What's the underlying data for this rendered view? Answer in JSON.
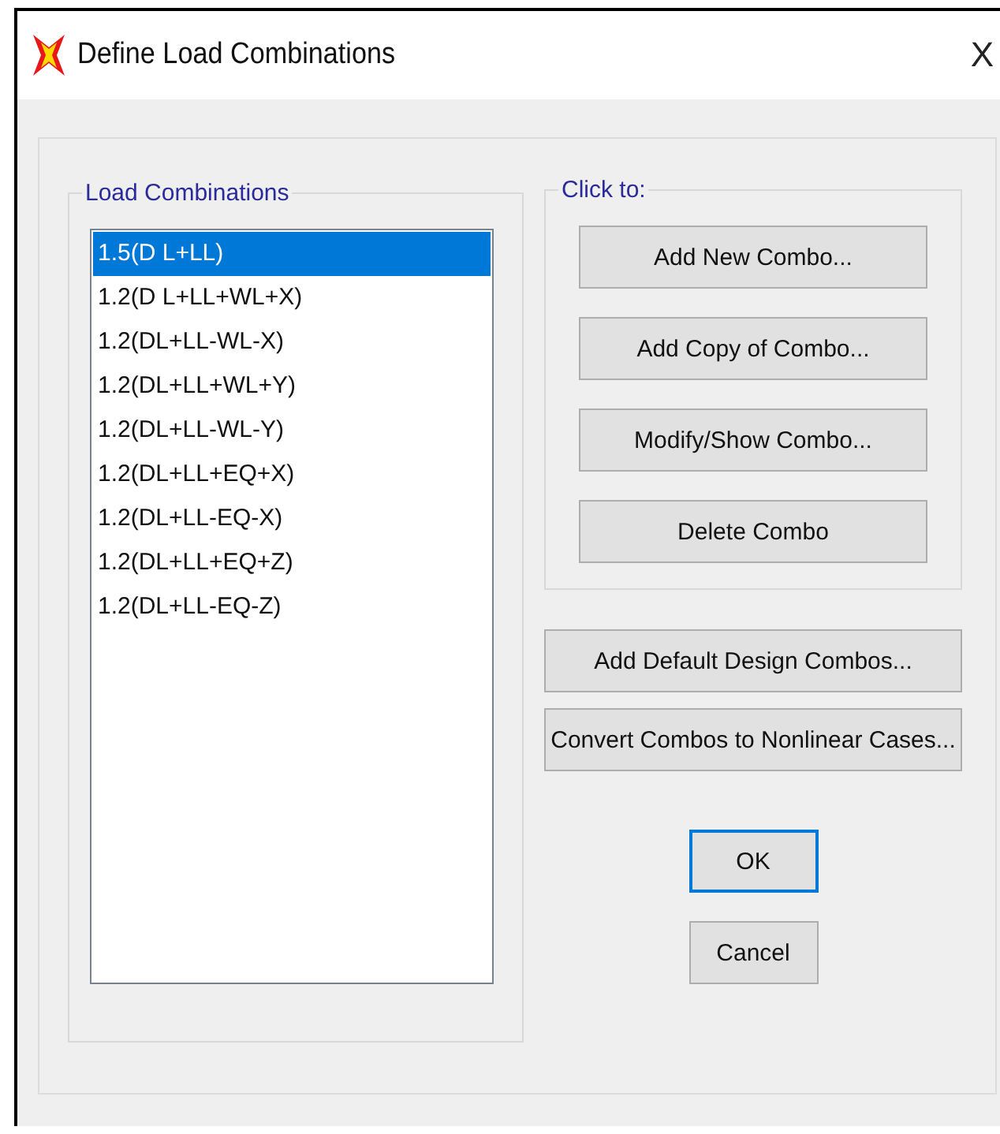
{
  "window": {
    "title": "Define Load Combinations",
    "close": "X"
  },
  "combinations": {
    "label": "Load Combinations",
    "items": [
      {
        "text": "1.5(D L+LL)",
        "selected": true
      },
      {
        "text": "1.2(D L+LL+WL+X)",
        "selected": false
      },
      {
        "text": "1.2(DL+LL-WL-X)",
        "selected": false
      },
      {
        "text": "1.2(DL+LL+WL+Y)",
        "selected": false
      },
      {
        "text": "1.2(DL+LL-WL-Y)",
        "selected": false
      },
      {
        "text": "1.2(DL+LL+EQ+X)",
        "selected": false
      },
      {
        "text": "1.2(DL+LL-EQ-X)",
        "selected": false
      },
      {
        "text": "1.2(DL+LL+EQ+Z)",
        "selected": false
      },
      {
        "text": "1.2(DL+LL-EQ-Z)",
        "selected": false
      }
    ]
  },
  "click_to": {
    "label": "Click to:",
    "buttons": [
      "Add New Combo...",
      "Add Copy of Combo...",
      "Modify/Show Combo...",
      "Delete Combo"
    ]
  },
  "extra_buttons": [
    "Add Default Design Combos...",
    "Convert Combos to Nonlinear Cases..."
  ],
  "dialog_buttons": [
    {
      "label": "OK",
      "focused": true
    },
    {
      "label": "Cancel",
      "focused": false
    }
  ]
}
